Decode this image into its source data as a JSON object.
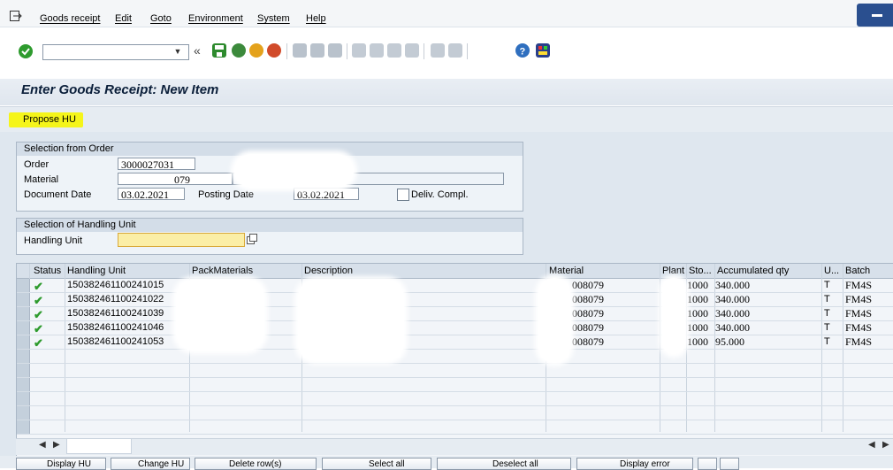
{
  "menu": {
    "items": [
      "Goods receipt",
      "Edit",
      "Goto",
      "Environment",
      "System",
      "Help"
    ]
  },
  "toolbar": {
    "command_value": "",
    "collapse_glyph": "«"
  },
  "title": "Enter Goods Receipt: New Item",
  "appbar": {
    "propose_hu": "Propose HU"
  },
  "selection_order": {
    "header": "Selection from Order",
    "order_label": "Order",
    "order_value": "3000027031",
    "material_label": "Material",
    "material_value": "079",
    "document_date_label": "Document Date",
    "document_date_value": "03.02.2021",
    "posting_date_label": "Posting Date",
    "posting_date_value": "03.02.2021",
    "deliv_compl_label": "Deliv. Compl."
  },
  "selection_hu": {
    "header": "Selection of Handling Unit",
    "hu_label": "Handling Unit",
    "hu_value": ""
  },
  "table": {
    "headers": [
      "Status",
      "Handling Unit",
      "PackMaterials",
      "Description",
      "Material",
      "Plant",
      "Sto...",
      "Accumulated qty",
      "U...",
      "Batch"
    ],
    "rows": [
      {
        "hu": "150382461100241015",
        "material": "008079",
        "plant": "1000",
        "qty": "340.000",
        "unit": "T",
        "batch": "FM4S"
      },
      {
        "hu": "150382461100241022",
        "material": "008079",
        "plant": "1000",
        "qty": "340.000",
        "unit": "T",
        "batch": "FM4S"
      },
      {
        "hu": "150382461100241039",
        "material": "008079",
        "plant": "1000",
        "qty": "340.000",
        "unit": "T",
        "batch": "FM4S"
      },
      {
        "hu": "150382461100241046",
        "material": "008079",
        "plant": "1000",
        "qty": "340.000",
        "unit": "T",
        "batch": "FM4S"
      },
      {
        "hu": "150382461100241053",
        "material": "008079",
        "plant": "1000",
        "qty": "95.000",
        "unit": "T",
        "batch": "FM4S"
      }
    ]
  },
  "bottom_buttons": [
    "Display HU",
    "Change HU",
    "Delete row(s)",
    "Select all",
    "Deselect all",
    "Display error"
  ],
  "colors": {
    "highlight": "#f5f51a",
    "status_ok": "#2e9b2e",
    "title_text": "#0b1f3a",
    "corner_button": "#2a4f8f"
  }
}
